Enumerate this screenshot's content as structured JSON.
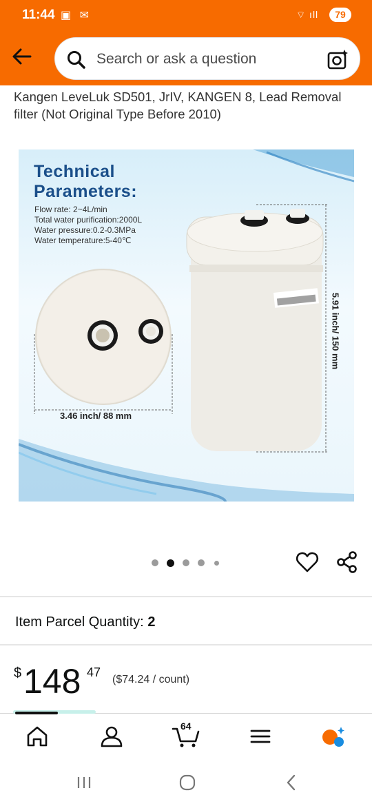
{
  "status_bar": {
    "time": "11:44",
    "battery": "79"
  },
  "search": {
    "placeholder": "Search or ask a question"
  },
  "product": {
    "title_line1": "Kangen LeveLuk SD501, JrIV, KANGEN 8, Lead Removal",
    "title_line2": "filter (Not Original Type Before 2010)"
  },
  "image": {
    "heading_line1": "Technical",
    "heading_line2": "Parameters:",
    "specs": [
      "Flow rate: 2~4L/min",
      "Total water purification:2000L",
      "Water pressure:0.2-0.3MPa",
      "Water temperature:5-40℃"
    ],
    "disc_dimension": "3.46 inch/ 88 mm",
    "height_dimension": "5.91 inch/ 150 mm"
  },
  "carousel": {
    "current_index": 2,
    "count": 5
  },
  "parcel": {
    "label": "Item Parcel Quantity:",
    "value": "2"
  },
  "price": {
    "currency": "$",
    "whole": "148",
    "fraction": "47",
    "unit_price": "($74.24 / count)"
  },
  "nav": {
    "cart_count": "64"
  },
  "colors": {
    "header": "#f76b00",
    "accent": "#1b4f8a"
  }
}
